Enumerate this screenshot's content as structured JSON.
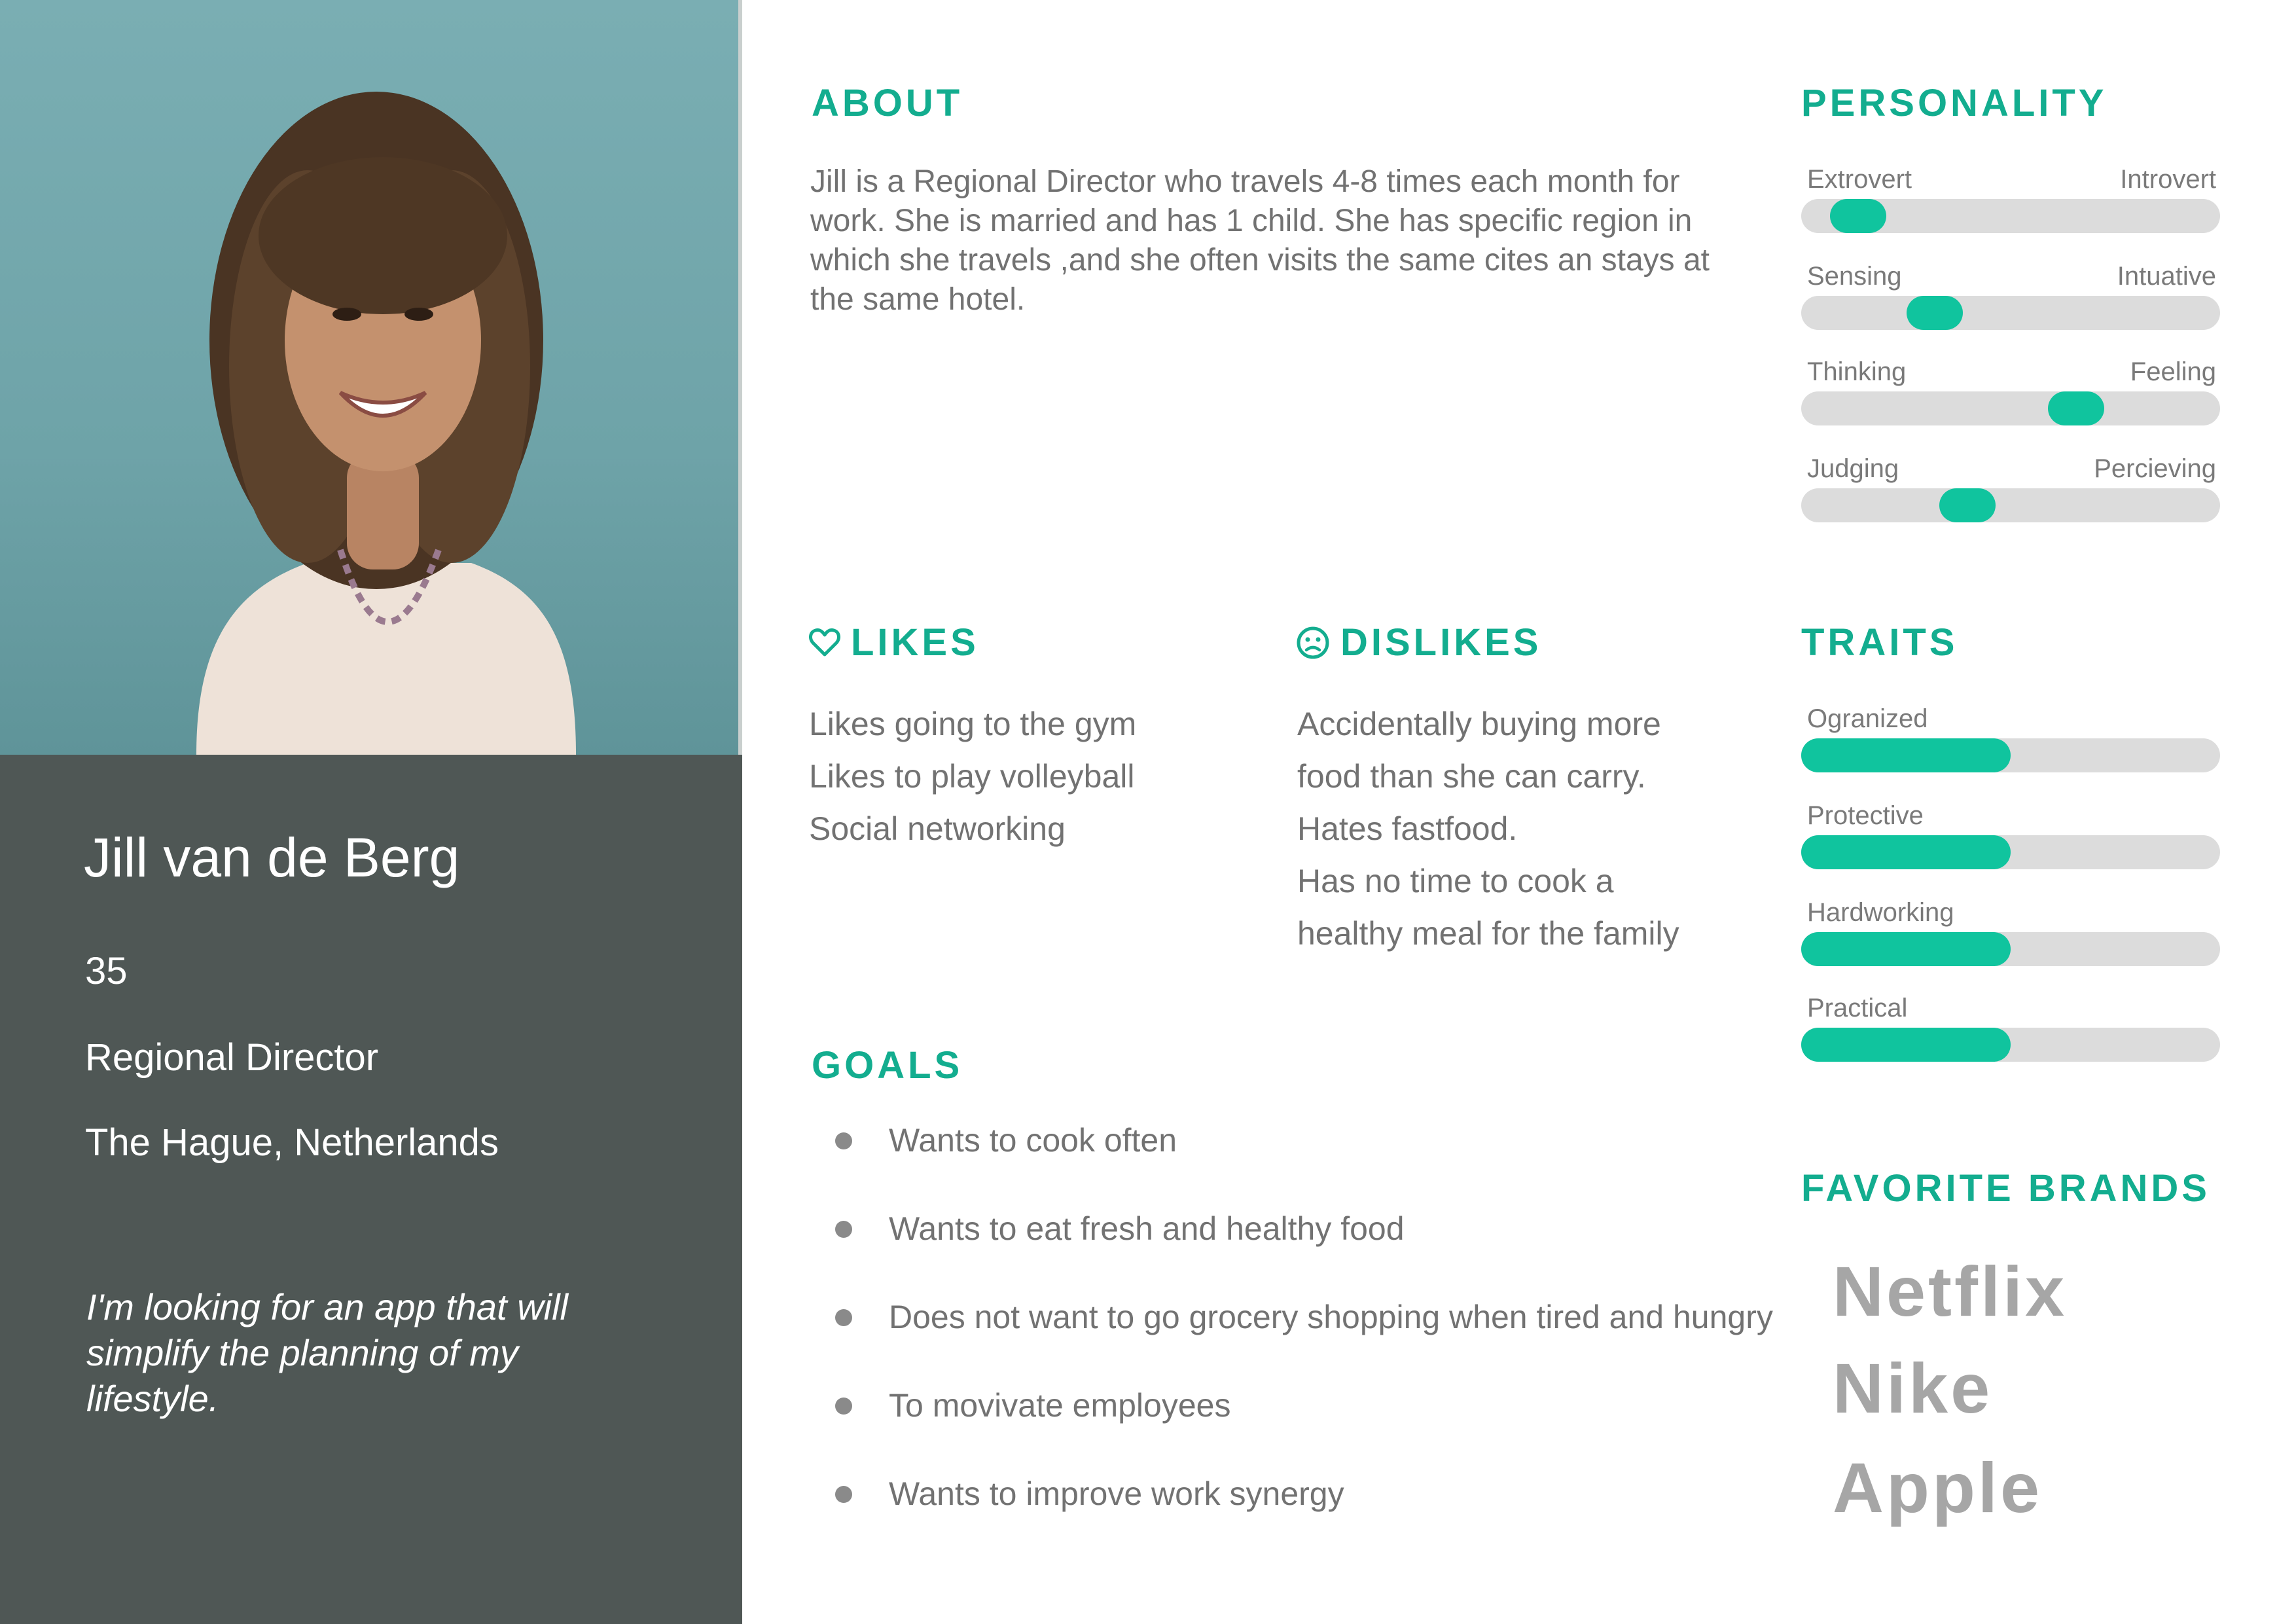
{
  "profile": {
    "name": "Jill van de Berg",
    "age": "35",
    "occupation": "Regional Director",
    "location": "The Hague, Netherlands",
    "quote": "I'm looking for an app that will simplify the planning of my lifestyle."
  },
  "about": {
    "heading": "ABOUT",
    "text": "Jill is a Regional Director who travels 4-8 times each month for work. She is married and has 1 child. She has specific region in which she travels ,and she often visits the same cites an stays at the same hotel."
  },
  "likes": {
    "heading": "LIKES",
    "icon": "heart-icon",
    "items": [
      "Likes going to the gym",
      "Likes to play volleyball",
      "Social networking"
    ]
  },
  "dislikes": {
    "heading": "DISLIKES",
    "icon": "sad-face-icon",
    "items": [
      "Accidentally buying more",
      "food than she can carry.",
      "Hates fastfood.",
      "Has no time to cook a",
      "healthy meal for the family"
    ]
  },
  "goals": {
    "heading": "GOALS",
    "items": [
      "Wants to cook often",
      "Wants to eat fresh and healthy food",
      "Does not want to go grocery shopping when tired and hungry",
      "To movivate employees",
      "Wants to improve work synergy"
    ]
  },
  "personality": {
    "heading": "PERSONALITY",
    "scales": [
      {
        "left": "Extrovert",
        "right": "Introvert",
        "value": 0.08
      },
      {
        "left": "Sensing",
        "right": "Intuative",
        "value": 0.29
      },
      {
        "left": "Thinking",
        "right": "Feeling",
        "value": 0.68
      },
      {
        "left": "Judging",
        "right": "Percieving",
        "value": 0.38
      }
    ]
  },
  "traits": {
    "heading": "TRAITS",
    "items": [
      {
        "label": "Ogranized",
        "value": 0.5
      },
      {
        "label": "Protective",
        "value": 0.5
      },
      {
        "label": "Hardworking",
        "value": 0.5
      },
      {
        "label": "Practical",
        "value": 0.5
      }
    ]
  },
  "brands": {
    "heading": "FAVORITE BRANDS",
    "items": [
      "Netflix",
      "Nike",
      "Apple"
    ]
  },
  "colors": {
    "accent": "#13ad8f",
    "slider_fill": "#10c49e",
    "slider_track": "#dcdcdc",
    "panel": "#4f5755",
    "body_text": "#727272",
    "brand_text": "#a6a6a6"
  }
}
